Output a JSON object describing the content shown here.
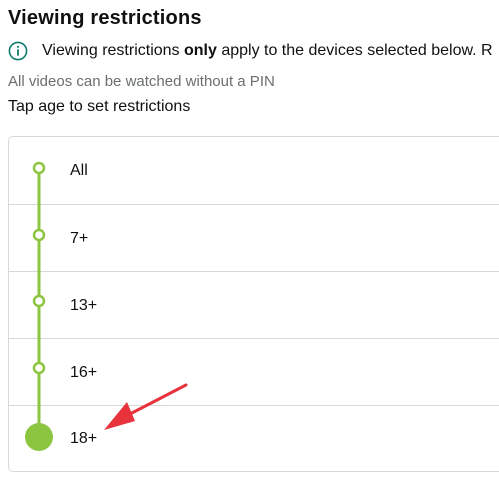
{
  "header": {
    "title": "Viewing restrictions",
    "info_text_before": "Viewing restrictions ",
    "info_text_bold": "only",
    "info_text_after": " apply to the devices selected below. R",
    "info_icon": "info-circle-icon"
  },
  "status_text": "All videos can be watched without a PIN",
  "tap_label": "Tap age to set restrictions",
  "age_options": [
    {
      "label": "All"
    },
    {
      "label": "7+"
    },
    {
      "label": "13+"
    },
    {
      "label": "16+"
    },
    {
      "label": "18+"
    }
  ],
  "selected_age": "18+",
  "colors": {
    "timeline": "#8cc540",
    "arrow": "#e8323c",
    "border": "#d5d9d9",
    "info_icon": "#0f7b6c"
  }
}
